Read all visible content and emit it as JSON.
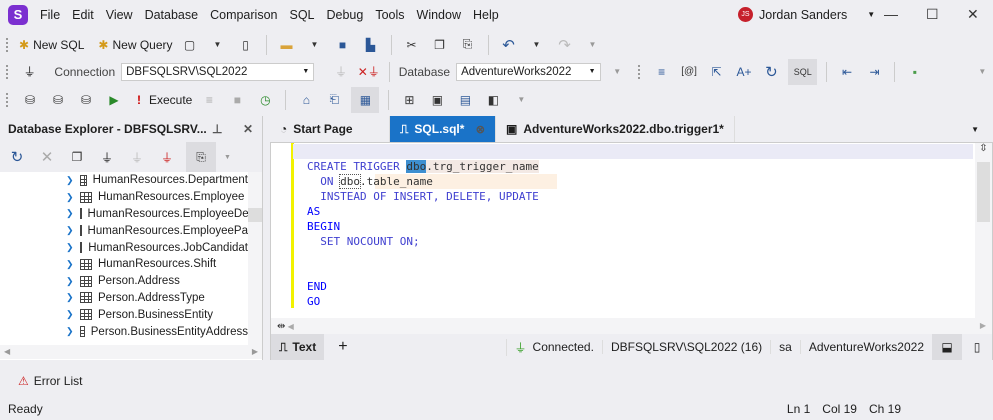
{
  "app": {
    "logo": "S",
    "menu": [
      "File",
      "Edit",
      "View",
      "Database",
      "Comparison",
      "SQL",
      "Debug",
      "Tools",
      "Window",
      "Help"
    ],
    "user": {
      "initials": "JS",
      "name": "Jordan  Sanders"
    }
  },
  "toolbar1": {
    "new_sql": "New SQL",
    "new_query": "New Query"
  },
  "toolbar2": {
    "connection_label": "Connection",
    "connection_value": "DBFSQLSRV\\SQL2022",
    "database_label": "Database",
    "database_value": "AdventureWorks2022",
    "sql_btn": "SQL"
  },
  "toolbar3": {
    "execute": "Execute"
  },
  "explorer": {
    "title": "Database Explorer - DBFSQLSRV...",
    "items": [
      "HumanResources.Department",
      "HumanResources.Employee",
      "HumanResources.EmployeeDep",
      "HumanResources.EmployeePay",
      "HumanResources.JobCandidat",
      "HumanResources.Shift",
      "Person.Address",
      "Person.AddressType",
      "Person.BusinessEntity",
      "Person.BusinessEntityAddress"
    ]
  },
  "tabs": [
    {
      "label": "Start Page"
    },
    {
      "label": "SQL.sql*"
    },
    {
      "label": "AdventureWorks2022.dbo.trigger1*"
    }
  ],
  "code": {
    "l1a": "CREATE TRIGGER ",
    "l1b": "dbo",
    ".l1c": "",
    "l1c": ".trg_trigger_name",
    "l2a": "  ON ",
    "l2b": "dbo",
    "l2c": ".table_name",
    "l3": "  INSTEAD OF INSERT, DELETE, UPDATE",
    "l4": "AS",
    "l5": "BEGIN",
    "l6": "  SET NOCOUNT ON;",
    "l9": "END",
    "l10": "GO"
  },
  "editor_bar": {
    "text_tab": "Text",
    "add": "+",
    "connected": "Connected.",
    "server": "DBFSQLSRV\\SQL2022 (16)",
    "user": "sa",
    "database": "AdventureWorks2022"
  },
  "error_list": "Error List",
  "status": {
    "ready": "Ready",
    "ln": "Ln 1",
    "col": "Col 19",
    "ch": "Ch 19"
  }
}
